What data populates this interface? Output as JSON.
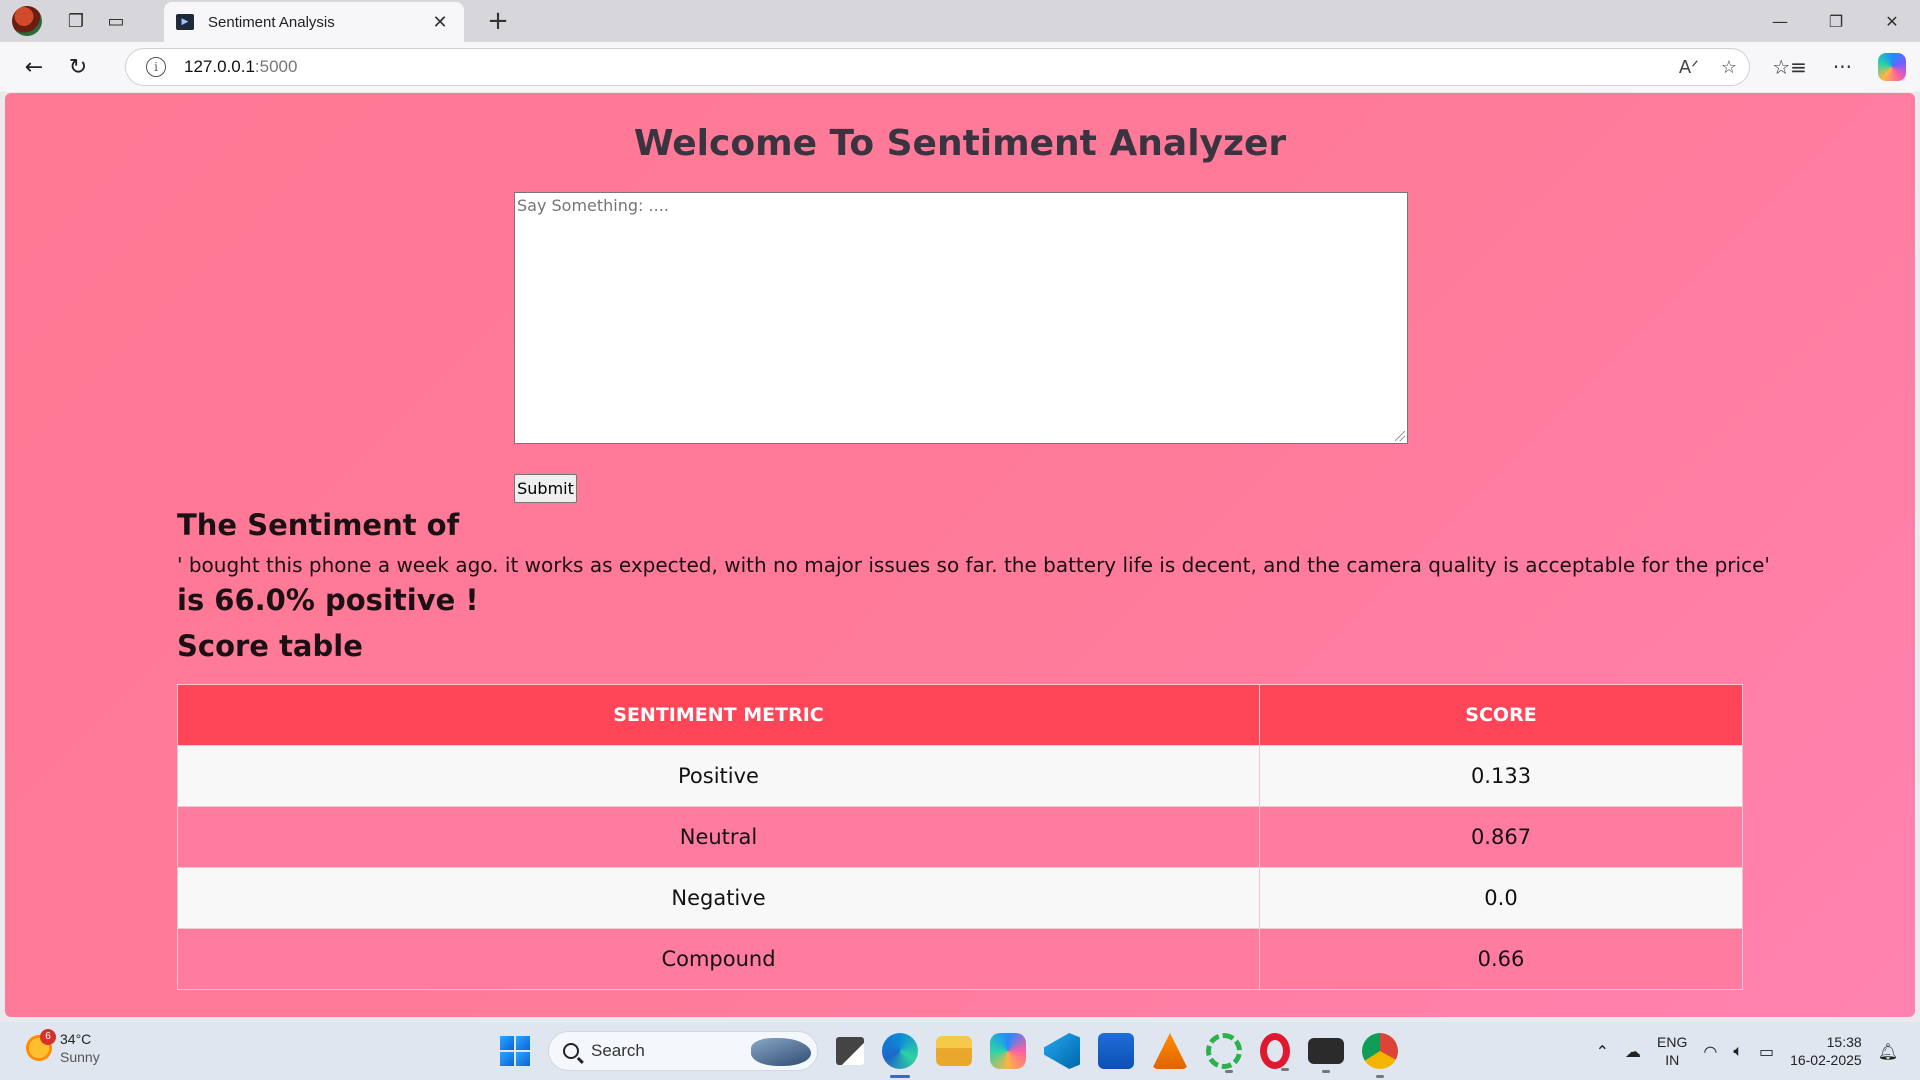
{
  "browser": {
    "tab_title": "Sentiment Analysis",
    "address_host": "127.0.0.1",
    "address_port": ":5000"
  },
  "page": {
    "heading": "Welcome To Sentiment Analyzer",
    "textarea_placeholder": "Say Something: ....",
    "submit_label": "Submit",
    "sentiment_heading": "The Sentiment of",
    "analyzed_text": "' bought this phone a week ago. it works as expected, with no major issues so far. the battery life is decent, and the camera quality is acceptable for the price'",
    "result_text": "is 66.0% positive !",
    "score_table_title": "Score table",
    "table": {
      "headers": [
        "SENTIMENT METRIC",
        "SCORE"
      ],
      "rows": [
        {
          "metric": "Positive",
          "score": "0.133"
        },
        {
          "metric": "Neutral",
          "score": "0.867"
        },
        {
          "metric": "Negative",
          "score": "0.0"
        },
        {
          "metric": "Compound",
          "score": "0.66"
        }
      ]
    }
  },
  "taskbar": {
    "weather_badge": "6",
    "weather_temp": "34°C",
    "weather_condition": "Sunny",
    "search_label": "Search",
    "lang_top": "ENG",
    "lang_bottom": "IN",
    "time": "15:38",
    "date": "16-02-2025"
  },
  "colors": {
    "page_bg": "#ff7b9a",
    "table_header": "#ff4659",
    "heading_text": "#3a3440"
  }
}
